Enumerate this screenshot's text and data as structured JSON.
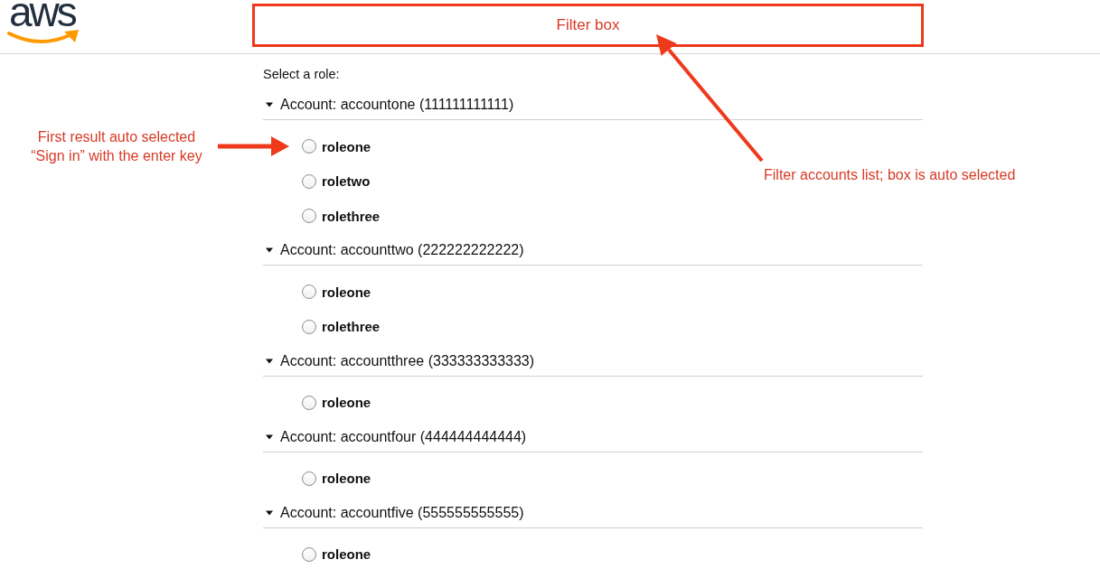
{
  "logo": {
    "text": "aws"
  },
  "filter_box": {
    "label": "Filter box"
  },
  "prompt": "Select a role:",
  "accounts": [
    {
      "label": "Account: accountone (111111111111)",
      "expanded": true,
      "roles": [
        {
          "name": "roleone",
          "selected": false
        },
        {
          "name": "roletwo",
          "selected": false
        },
        {
          "name": "rolethree",
          "selected": false
        }
      ]
    },
    {
      "label": "Account: accounttwo (222222222222)",
      "expanded": true,
      "roles": [
        {
          "name": "roleone",
          "selected": false
        },
        {
          "name": "rolethree",
          "selected": false
        }
      ]
    },
    {
      "label": "Account: accountthree (333333333333)",
      "expanded": true,
      "roles": [
        {
          "name": "roleone",
          "selected": false
        }
      ]
    },
    {
      "label": "Account: accountfour (444444444444)",
      "expanded": true,
      "roles": [
        {
          "name": "roleone",
          "selected": false
        }
      ]
    },
    {
      "label": "Account: accountfive (555555555555)",
      "expanded": true,
      "roles": [
        {
          "name": "roleone",
          "selected": false
        }
      ]
    }
  ],
  "annotations": [
    {
      "lines": [
        "First result auto selected",
        "“Sign in” with the enter key"
      ]
    },
    {
      "lines": [
        "Filter accounts list; box is auto selected"
      ]
    }
  ]
}
